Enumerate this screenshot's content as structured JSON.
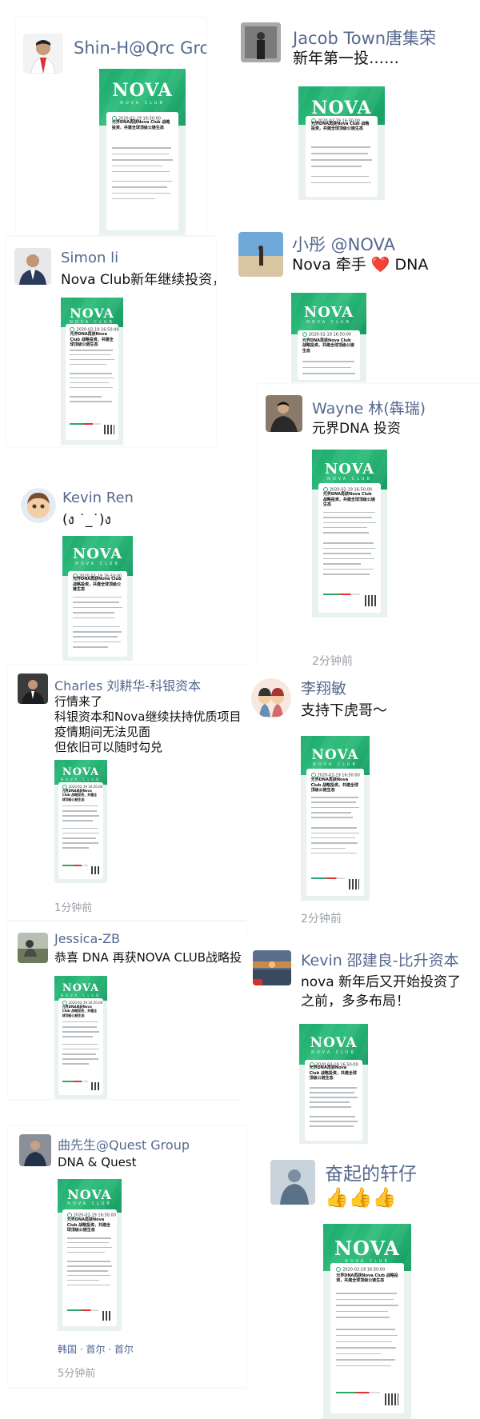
{
  "nova": {
    "logo": "NOVA",
    "club": "NOVA CLUB",
    "date": "2020-02-19 16:50:00",
    "headline": "元界DNA再获Nova Club 战略投资，共建全球顶级公链生态"
  },
  "posts": [
    {
      "name": "Shin-H@Qrc Group",
      "message": ""
    },
    {
      "name": "Jacob Town唐集荣",
      "message": "新年第一投……"
    },
    {
      "name": "Simon li",
      "message": "Nova Club新年继续投资，"
    },
    {
      "name": "小彤 @NOVA",
      "message": "Nova 牵手 ❤️ DNA"
    },
    {
      "name": "Wayne 林(犇瑞)",
      "message": "元界DNA 投资"
    },
    {
      "name": "Kevin Ren",
      "message": "(ง ˙_˙)ง"
    },
    {
      "name": "Charles 刘耕华-科银资本",
      "message": "行情来了\n科银资本和Nova继续扶持优质项目\n疫情期间无法见面\n但依旧可以随时勾兑",
      "time": "1分钟前"
    },
    {
      "name": "李翔敏",
      "message": "支持下虎哥～",
      "time": "2分钟前"
    },
    {
      "name": "Jessica-ZB",
      "message": "恭喜 DNA 再获NOVA CLUB战略投"
    },
    {
      "name": "Kevin 邵建良-比升资本",
      "message": "nova 新年后又开始投资了\n之前，多多布局！"
    },
    {
      "name": "曲先生@Quest Group",
      "message": "DNA & Quest",
      "location": "韩国 · 首尔 · 首尔",
      "time": "5分钟前"
    },
    {
      "name": "奋起的轩仔",
      "message": "👍👍👍"
    }
  ],
  "partial_time": "2分钟前"
}
